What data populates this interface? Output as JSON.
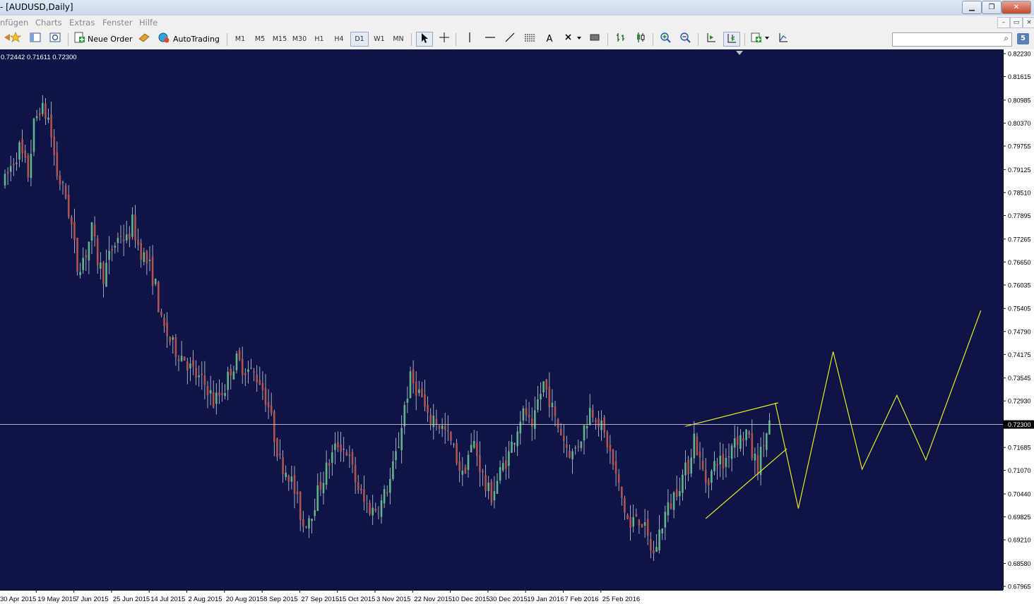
{
  "window": {
    "title": "- [AUDUSD,Daily]",
    "buttons": {
      "minimize": "▁",
      "restore": "❐",
      "close": "✕"
    }
  },
  "menu": {
    "items": [
      "nfügen",
      "Charts",
      "Extras",
      "Fenster",
      "Hilfe"
    ],
    "mdi": {
      "minimize": "–",
      "restore": "▭",
      "close": "×"
    }
  },
  "toolbar": {
    "new_order_label": "Neue Order",
    "autotrading_label": "AutoTrading",
    "timeframes": [
      "M1",
      "M5",
      "M15",
      "M30",
      "H1",
      "H4",
      "D1",
      "W1",
      "MN"
    ],
    "active_timeframe": "D1",
    "text_tool_label": "A"
  },
  "search": {
    "placeholder": "",
    "value": "",
    "help_badge": "5"
  },
  "colors": {
    "background": "#0e1445",
    "bull_candle": "#62b38a",
    "bear_candle": "#b0524e",
    "wick": "#ccccd6",
    "drawing": "#e8e826",
    "price_line": "#c8c8cc",
    "axis_text": "#ffffff"
  },
  "chart_data": {
    "type": "candlestick",
    "symbol": "AUDUSD",
    "timeframe": "Daily",
    "ohlc_readout": "0.72442 0.71611 0.72300",
    "current_price": "0.72300",
    "y_ticks": [
      "0.82230",
      "0.81615",
      "0.80985",
      "0.80370",
      "0.79755",
      "0.79125",
      "0.78510",
      "0.77895",
      "0.77265",
      "0.76650",
      "0.76035",
      "0.75405",
      "0.74790",
      "0.74175",
      "0.73545",
      "0.72930",
      "0.72300",
      "0.71685",
      "0.71070",
      "0.70440",
      "0.69825",
      "0.69210",
      "0.68580",
      "0.67965"
    ],
    "ylim": [
      0.67965,
      0.8223
    ],
    "x_labels": [
      "30 Apr 2015",
      "19 May 2015",
      "7 Jun 2015",
      "25 Jun 2015",
      "14 Jul 2015",
      "2 Aug 2015",
      "20 Aug 2015",
      "8 Sep 2015",
      "27 Sep 2015",
      "15 Oct 2015",
      "3 Nov 2015",
      "22 Nov 2015",
      "10 Dec 2015",
      "30 Dec 2015",
      "19 Jan 2016",
      "7 Feb 2016",
      "25 Feb 2016"
    ],
    "price_path": [
      [
        0,
        0.788
      ],
      [
        2,
        0.792
      ],
      [
        5,
        0.797
      ],
      [
        8,
        0.79
      ],
      [
        10,
        0.803
      ],
      [
        12,
        0.808
      ],
      [
        15,
        0.805
      ],
      [
        18,
        0.79
      ],
      [
        21,
        0.784
      ],
      [
        23,
        0.776
      ],
      [
        25,
        0.765
      ],
      [
        28,
        0.769
      ],
      [
        30,
        0.775
      ],
      [
        32,
        0.767
      ],
      [
        34,
        0.763
      ],
      [
        37,
        0.77
      ],
      [
        40,
        0.774
      ],
      [
        42,
        0.772
      ],
      [
        44,
        0.777
      ],
      [
        46,
        0.771
      ],
      [
        48,
        0.768
      ],
      [
        50,
        0.765
      ],
      [
        52,
        0.76
      ],
      [
        54,
        0.75
      ],
      [
        56,
        0.747
      ],
      [
        58,
        0.744
      ],
      [
        60,
        0.742
      ],
      [
        62,
        0.741
      ],
      [
        64,
        0.738
      ],
      [
        67,
        0.735
      ],
      [
        70,
        0.733
      ],
      [
        72,
        0.729
      ],
      [
        74,
        0.731
      ],
      [
        76,
        0.733
      ],
      [
        78,
        0.738
      ],
      [
        80,
        0.74
      ],
      [
        83,
        0.738
      ],
      [
        85,
        0.737
      ],
      [
        88,
        0.735
      ],
      [
        91,
        0.728
      ],
      [
        93,
        0.72
      ],
      [
        95,
        0.713
      ],
      [
        98,
        0.71
      ],
      [
        100,
        0.705
      ],
      [
        103,
        0.696
      ],
      [
        106,
        0.7
      ],
      [
        109,
        0.707
      ],
      [
        112,
        0.713
      ],
      [
        115,
        0.718
      ],
      [
        118,
        0.716
      ],
      [
        121,
        0.708
      ],
      [
        124,
        0.702
      ],
      [
        127,
        0.7
      ],
      [
        130,
        0.702
      ],
      [
        133,
        0.708
      ],
      [
        136,
        0.718
      ],
      [
        138,
        0.728
      ],
      [
        140,
        0.735
      ],
      [
        142,
        0.733
      ],
      [
        144,
        0.73
      ],
      [
        146,
        0.724
      ],
      [
        148,
        0.725
      ],
      [
        150,
        0.723
      ],
      [
        152,
        0.721
      ],
      [
        154,
        0.718
      ],
      [
        156,
        0.714
      ],
      [
        158,
        0.709
      ],
      [
        160,
        0.715
      ],
      [
        162,
        0.718
      ],
      [
        164,
        0.712
      ],
      [
        166,
        0.706
      ],
      [
        168,
        0.704
      ],
      [
        170,
        0.708
      ],
      [
        172,
        0.712
      ],
      [
        174,
        0.715
      ],
      [
        176,
        0.72
      ],
      [
        178,
        0.725
      ],
      [
        180,
        0.726
      ],
      [
        182,
        0.72
      ],
      [
        184,
        0.729
      ],
      [
        186,
        0.734
      ],
      [
        188,
        0.73
      ],
      [
        190,
        0.724
      ],
      [
        192,
        0.721
      ],
      [
        194,
        0.717
      ],
      [
        196,
        0.715
      ],
      [
        198,
        0.718
      ],
      [
        200,
        0.722
      ],
      [
        202,
        0.727
      ],
      [
        204,
        0.726
      ],
      [
        206,
        0.722
      ],
      [
        208,
        0.718
      ],
      [
        210,
        0.712
      ],
      [
        212,
        0.706
      ],
      [
        214,
        0.7
      ],
      [
        216,
        0.695
      ],
      [
        218,
        0.699
      ],
      [
        220,
        0.697
      ],
      [
        222,
        0.692
      ],
      [
        224,
        0.688
      ],
      [
        226,
        0.694
      ],
      [
        228,
        0.699
      ],
      [
        230,
        0.702
      ],
      [
        232,
        0.706
      ],
      [
        234,
        0.709
      ],
      [
        236,
        0.712
      ],
      [
        238,
        0.72
      ],
      [
        240,
        0.713
      ],
      [
        242,
        0.708
      ],
      [
        244,
        0.71
      ],
      [
        246,
        0.714
      ],
      [
        248,
        0.712
      ],
      [
        250,
        0.716
      ],
      [
        252,
        0.72
      ],
      [
        254,
        0.719
      ],
      [
        256,
        0.721
      ],
      [
        258,
        0.715
      ],
      [
        260,
        0.712
      ],
      [
        262,
        0.718
      ],
      [
        264,
        0.723
      ]
    ],
    "candle_count": 265,
    "x_axis_labels_at": [
      0,
      13,
      26,
      39,
      52,
      65,
      78,
      91,
      104,
      117,
      130,
      143,
      156,
      169,
      182,
      195,
      208
    ],
    "drawings": {
      "wedge_upper": [
        [
          235,
          0.7225
        ],
        [
          267,
          0.7288
        ]
      ],
      "wedge_lower": [
        [
          242,
          0.6978
        ],
        [
          270,
          0.7165
        ]
      ],
      "zigzag": [
        [
          266,
          0.7288
        ],
        [
          274,
          0.7005
        ],
        [
          286,
          0.7425
        ],
        [
          296,
          0.711
        ],
        [
          308,
          0.7308
        ],
        [
          318,
          0.7135
        ],
        [
          337,
          0.7535
        ]
      ]
    }
  }
}
